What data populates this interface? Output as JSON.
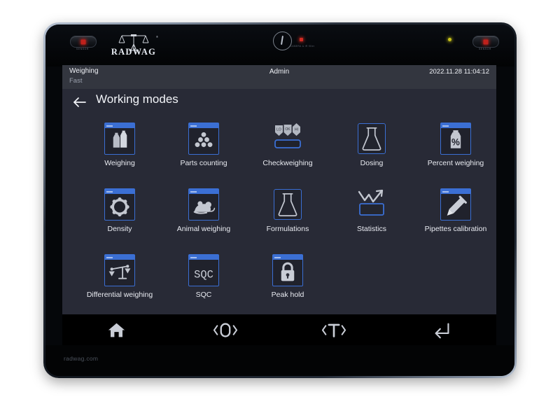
{
  "device": {
    "brand": "RADWAG",
    "brand_reg": "®",
    "sensor_left_label": "SENSOR",
    "sensor_right_label": "SENSOR",
    "power_label": "CAMERA & IR filter",
    "site_url": "radwag.com"
  },
  "statusbar": {
    "mode": "Weighing",
    "profile": "Fast",
    "user": "Admin",
    "datetime": "2022.11.28 11:04:12"
  },
  "header": {
    "back_label": "back-arrow",
    "title": "Working modes"
  },
  "modes": [
    {
      "label": "Weighing",
      "icon": "weights-icon",
      "frame": "window"
    },
    {
      "label": "Parts counting",
      "icon": "parts-dots-icon",
      "frame": "window"
    },
    {
      "label": "Checkweighing",
      "icon": "lo-ok-hi-bar-icon",
      "frame": "none"
    },
    {
      "label": "Dosing",
      "icon": "flask-icon",
      "frame": "plain"
    },
    {
      "label": "Percent weighing",
      "icon": "weight-percent-icon",
      "frame": "window"
    },
    {
      "label": "Density",
      "icon": "gear-ring-icon",
      "frame": "window"
    },
    {
      "label": "Animal weighing",
      "icon": "mouse-icon",
      "frame": "window"
    },
    {
      "label": "Formulations",
      "icon": "flask-icon",
      "frame": "plain"
    },
    {
      "label": "Statistics",
      "icon": "zigzag-chart-icon",
      "frame": "none"
    },
    {
      "label": "Pipettes calibration",
      "icon": "pipette-icon",
      "frame": "window"
    },
    {
      "label": "Differential weighing",
      "icon": "balance-scale-icon",
      "frame": "window"
    },
    {
      "label": "SQC",
      "icon": "sqc-text-icon",
      "frame": "window"
    },
    {
      "label": "Peak hold",
      "icon": "padlock-icon",
      "frame": "window"
    }
  ],
  "checkweighing_badges": [
    "LO",
    "OK",
    "HI"
  ],
  "sqc_text": "SQC",
  "toolbar": [
    {
      "name": "home-button",
      "icon": "home-icon",
      "label": "Home"
    },
    {
      "name": "zero-button",
      "icon": "zero-icon",
      "label": "›0‹"
    },
    {
      "name": "tare-button",
      "icon": "tare-icon",
      "label": "›T‹"
    },
    {
      "name": "enter-button",
      "icon": "enter-icon",
      "label": "Enter"
    }
  ],
  "colors": {
    "accent_blue": "#3b6fd4",
    "screen_bg": "#282a36",
    "statusbar_bg": "#33363f",
    "icon_grey": "#b8bcc6",
    "text": "#e9ebf1"
  }
}
